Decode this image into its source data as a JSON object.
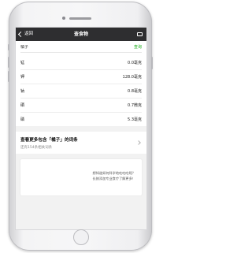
{
  "nav": {
    "back_label": "返回",
    "title": "查食物"
  },
  "search": {
    "query": "橘子",
    "button_label": "查询"
  },
  "nutrients": [
    {
      "name": "锰",
      "value": "0.0毫克"
    },
    {
      "name": "钾",
      "value": "128.0毫克"
    },
    {
      "name": "钠",
      "value": "0.8毫克"
    },
    {
      "name": "硒",
      "value": "0.7微克"
    },
    {
      "name": "磷",
      "value": "5.3毫克"
    }
  ],
  "more": {
    "title": "查看更多包含「橘子」的词条",
    "subtitle": "还有154条相关词条"
  },
  "promo": {
    "line1": "想知道如何科学地吃吃吃呢？",
    "line2": "长按添加专业食疗了解更多！"
  }
}
